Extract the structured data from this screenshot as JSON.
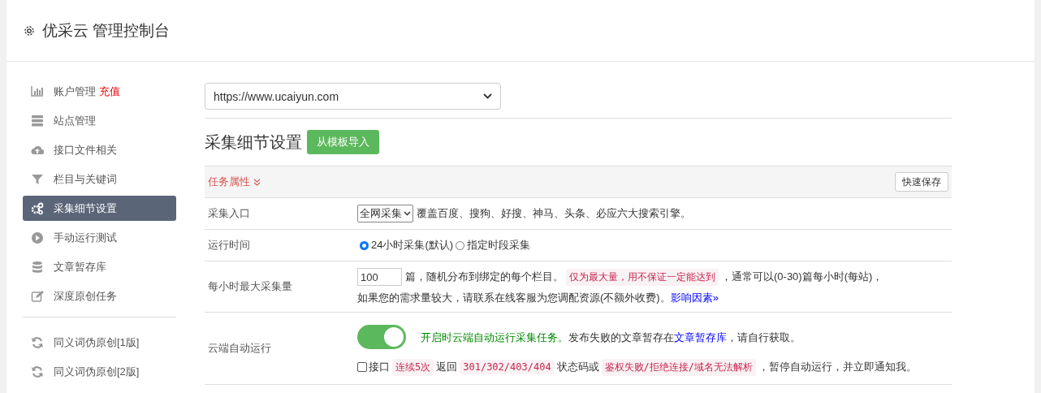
{
  "header": {
    "title": "优采云 管理控制台"
  },
  "sidebar": {
    "groups": [
      [
        {
          "label": "账户管理",
          "badge": "充值",
          "selected": false
        },
        {
          "label": "站点管理",
          "selected": false
        },
        {
          "label": "接口文件相关",
          "selected": false
        },
        {
          "label": "栏目与关键词",
          "selected": false
        },
        {
          "label": "采集细节设置",
          "selected": true
        },
        {
          "label": "手动运行测试",
          "selected": false
        },
        {
          "label": "文章暂存库",
          "selected": false
        },
        {
          "label": "深度原创任务",
          "selected": false
        }
      ],
      [
        {
          "label": "同义词伪原创[1版]",
          "selected": false
        },
        {
          "label": "同义词伪原创[2版]",
          "selected": false
        }
      ]
    ]
  },
  "site_select": {
    "value": "https://www.ucaiyun.com"
  },
  "section": {
    "title": "采集细节设置",
    "import_button": "从模板导入"
  },
  "panel": {
    "title": "任务属性",
    "save_button": "快速保存",
    "rows": [
      {
        "kind": "select",
        "label": "采集入口",
        "value": "全网采集",
        "text": "覆盖百度、搜狗、好搜、神马、头条、必应六大搜索引擎。"
      },
      {
        "kind": "radio",
        "label": "运行时间",
        "options": [
          {
            "label": "24小时采集(默认)",
            "selected": true
          },
          {
            "label": "指定时段采集",
            "selected": false
          }
        ]
      },
      {
        "kind": "number",
        "label": "每小时最大采集量",
        "value": "100",
        "lines": [
          [
            {
              "kind": "text",
              "text": "篇，随机分布到绑定的每个栏目。"
            },
            {
              "kind": "tag",
              "text": "仅为最大量，用不保证一定能达到"
            },
            {
              "kind": "text",
              "text": "，通常可以(0-30)篇每小时(每站)，"
            }
          ],
          [
            {
              "kind": "text",
              "text": "如果您的需求量较大，请联系在线客服为您调配资源(不额外收费)。"
            },
            {
              "kind": "link",
              "text": "影响因素»"
            }
          ]
        ]
      },
      {
        "kind": "toggle",
        "label": "云端自动运行",
        "on": true,
        "checked": false,
        "lines": [
          [
            {
              "kind": "green",
              "text": "开启时云端自动运行采集任务。"
            },
            {
              "kind": "text",
              "text": "发布失败的文章暂存在"
            },
            {
              "kind": "link",
              "text": "文章暂存库"
            },
            {
              "kind": "text",
              "text": "，请自行获取。"
            }
          ],
          [
            {
              "kind": "text",
              "text": "接口"
            },
            {
              "kind": "tag",
              "text": "连续5次"
            },
            {
              "kind": "text",
              "text": "返回"
            },
            {
              "kind": "tag",
              "text": "301/302/403/404"
            },
            {
              "kind": "text",
              "text": "状态码或"
            },
            {
              "kind": "tag",
              "text": "鉴权失败/拒绝连接/域名无法解析"
            },
            {
              "kind": "text",
              "text": "，暂停自动运行，并立即通知我。"
            }
          ]
        ]
      }
    ]
  }
}
